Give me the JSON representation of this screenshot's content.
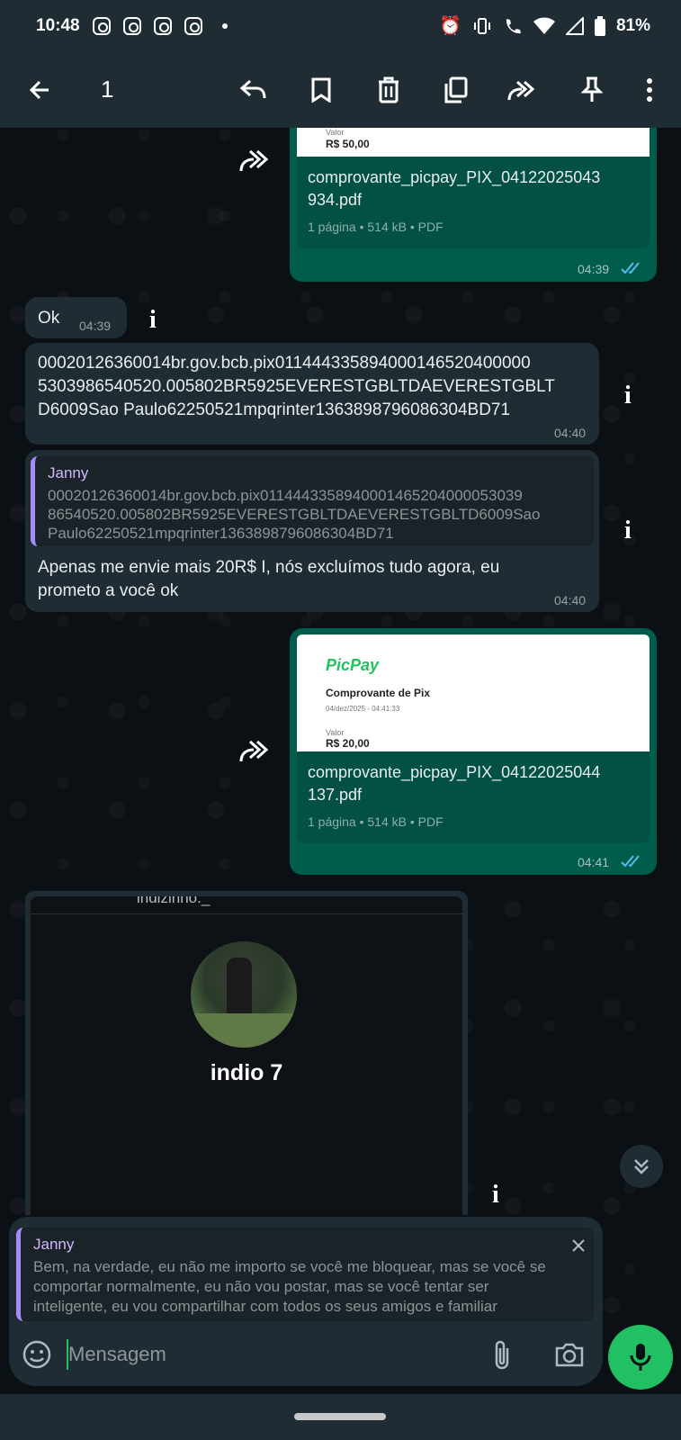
{
  "status_bar": {
    "time": "10:48",
    "battery": "81%"
  },
  "action_bar": {
    "selected_count": "1",
    "icons": [
      "back-arrow-icon",
      "reply-icon",
      "bookmark-icon",
      "delete-icon",
      "copy-icon",
      "forward-icon",
      "pin-icon",
      "more-vert-icon"
    ]
  },
  "messages": {
    "m1": {
      "thumb_label": "Valor",
      "thumb_value": "R$ 50,00",
      "file_name": "comprovante_picpay_PIX_04122025043934.pdf",
      "file_name_l1": "comprovante_picpay_PIX_04122025043",
      "file_name_l2": "934.pdf",
      "meta": "1 página • 514 kB • PDF",
      "time": "04:39"
    },
    "m2": {
      "text": "Ok",
      "time": "04:39"
    },
    "m3": {
      "line1": "00020126360014br.gov.bcb.pix011444335894000146520400000",
      "line2": "5303986540520.005802BR5925EVERESTGBLTDAEVERESTGBLT",
      "line3": "D6009Sao Paulo62250521mpqrinter1363898796086304BD71",
      "time": "04:40"
    },
    "m4": {
      "quote_name": "Janny",
      "quote_l1": "00020126360014br.gov.bcb.pix0114443358940001465204000053039",
      "quote_l2": "86540520.005802BR5925EVERESTGBLTDAEVERESTGBLTD6009Sao",
      "quote_l3": "Paulo62250521mpqrinter1363898796086304BD71",
      "text_l1": "Apenas me envie mais 20R$ I, nós excluímos tudo agora, eu",
      "text_l2": "prometo a você ok",
      "time": "04:40"
    },
    "m5": {
      "brand": "PicPay",
      "thumb_title": "Comprovante de Pix",
      "thumb_date": "04/dez/2025 - 04:41:33",
      "thumb_label": "Valor",
      "thumb_value": "R$ 20,00",
      "file_name_l1": "comprovante_picpay_PIX_04122025044",
      "file_name_l2": "137.pdf",
      "meta": "1 página • 514 kB • PDF",
      "time": "04:41"
    },
    "m6": {
      "username": "indizinho._",
      "profile_name": "indio 7"
    }
  },
  "reply_panel": {
    "name": "Janny",
    "text_l1": "Bem, na verdade, eu não me importo se você me bloquear, mas se você se",
    "text_l2": "comportar normalmente, eu não vou postar, mas se você tentar ser",
    "text_l3": "inteligente, eu vou compartilhar com todos os seus amigos e familiar"
  },
  "input": {
    "placeholder": "Mensagem"
  },
  "colors": {
    "outgoing": "#005c4b",
    "incoming": "#1f2c34",
    "accent": "#21c063",
    "read_ticks": "#53bdeb",
    "quote_bar": "#a78bfa"
  }
}
